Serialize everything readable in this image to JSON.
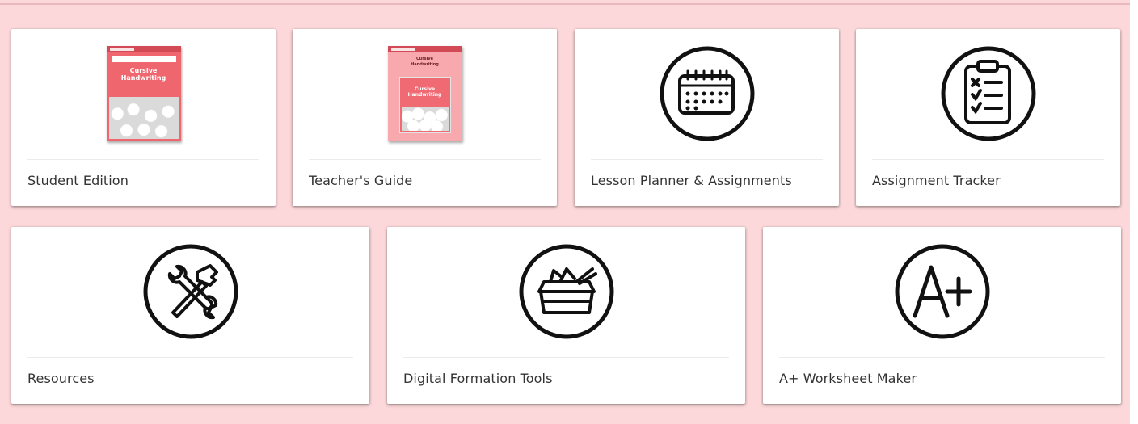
{
  "cards_row1": [
    {
      "label": "Student Edition",
      "icon": "student-edition-book-cover",
      "cover_title": [
        "Cursive",
        "Handwriting"
      ]
    },
    {
      "label": "Teacher's Guide",
      "icon": "teachers-guide-book-cover",
      "cover_title": [
        "Cursive",
        "Handwriting"
      ]
    },
    {
      "label": "Lesson Planner & Assignments",
      "icon": "calendar-icon"
    },
    {
      "label": "Assignment Tracker",
      "icon": "clipboard-checklist-icon"
    }
  ],
  "cards_row2": [
    {
      "label": "Resources",
      "icon": "wrench-hammer-icon"
    },
    {
      "label": "Digital Formation Tools",
      "icon": "supply-box-icon"
    },
    {
      "label": "A+ Worksheet Maker",
      "icon": "a-plus-icon"
    }
  ],
  "colors": {
    "page_background": "#fcd8da",
    "card_background": "#ffffff",
    "book_cover": "#f0666f",
    "label_text": "#333333"
  }
}
